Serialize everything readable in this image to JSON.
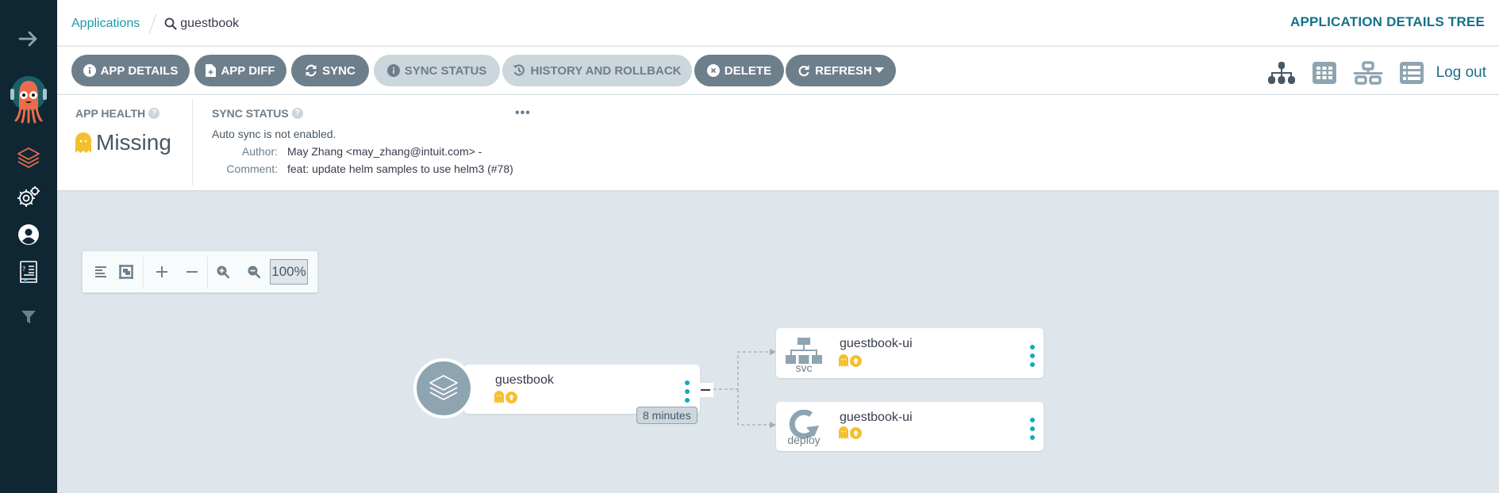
{
  "sidebar": {
    "items": [
      {
        "name": "expand-sidebar",
        "icon": "arrow-right-icon"
      },
      {
        "name": "logo",
        "icon": "argo-logo-icon"
      },
      {
        "name": "applications",
        "icon": "layers-icon"
      },
      {
        "name": "settings",
        "icon": "gear-icon"
      },
      {
        "name": "user-info",
        "icon": "user-icon"
      },
      {
        "name": "documentation",
        "icon": "help-book-icon"
      },
      {
        "name": "filter",
        "icon": "filter-icon"
      }
    ]
  },
  "header": {
    "breadcrumb_root": "Applications",
    "breadcrumb_current": "guestbook",
    "page_title": "APPLICATION DETAILS TREE"
  },
  "toolbar": {
    "buttons": [
      {
        "label": "APP DETAILS",
        "icon": "info-circle-icon",
        "enabled": true
      },
      {
        "label": "APP DIFF",
        "icon": "file-diff-icon",
        "enabled": true
      },
      {
        "label": "SYNC",
        "icon": "sync-icon",
        "enabled": true
      },
      {
        "label": "SYNC STATUS",
        "icon": "info-circle-icon",
        "enabled": false
      },
      {
        "label": "HISTORY AND ROLLBACK",
        "icon": "history-icon",
        "enabled": false
      },
      {
        "label": "DELETE",
        "icon": "times-circle-icon",
        "enabled": true
      },
      {
        "label": "REFRESH",
        "icon": "redo-icon",
        "enabled": true
      }
    ],
    "views": [
      {
        "name": "tree",
        "icon": "sitemap-icon",
        "active": true
      },
      {
        "name": "pods",
        "icon": "grid-icon",
        "active": false
      },
      {
        "name": "network",
        "icon": "network-icon",
        "active": false
      },
      {
        "name": "list",
        "icon": "list-icon",
        "active": false
      }
    ],
    "logout_label": "Log out"
  },
  "status_panel": {
    "app_health_title": "APP HEALTH",
    "app_health_value": "Missing",
    "sync_status_title": "SYNC STATUS",
    "help_glyph": "?",
    "more_glyph": "•••",
    "auto_sync_message": "Auto sync is not enabled.",
    "author_label": "Author:",
    "author_value": "May Zhang <may_zhang@intuit.com> -",
    "comment_label": "Comment:",
    "comment_value": "feat: update helm samples to use helm3 (#78)"
  },
  "graph_controls": {
    "zoom_level": "100%"
  },
  "graph": {
    "root": {
      "name": "guestbook",
      "kind_icon": "layers-icon",
      "health": "Missing",
      "sync": "OutOfSync",
      "age": "8 minutes"
    },
    "children": [
      {
        "name": "guestbook-ui",
        "kind": "svc",
        "health": "Missing",
        "sync": "OutOfSync"
      },
      {
        "name": "guestbook-ui",
        "kind": "deploy",
        "health": "Missing",
        "sync": "OutOfSync"
      }
    ]
  },
  "colors": {
    "sidebar_bg": "#0f2733",
    "accent_teal": "#1b9aaa",
    "title_teal": "#15708a",
    "button_bg": "#6d7f8b",
    "button_disabled_bg": "#ccd6dd",
    "canvas_bg": "#dee6eb",
    "missing_yellow": "#f4c030",
    "kebab_teal": "#0dadbd",
    "argo_orange": "#e96d4c"
  }
}
